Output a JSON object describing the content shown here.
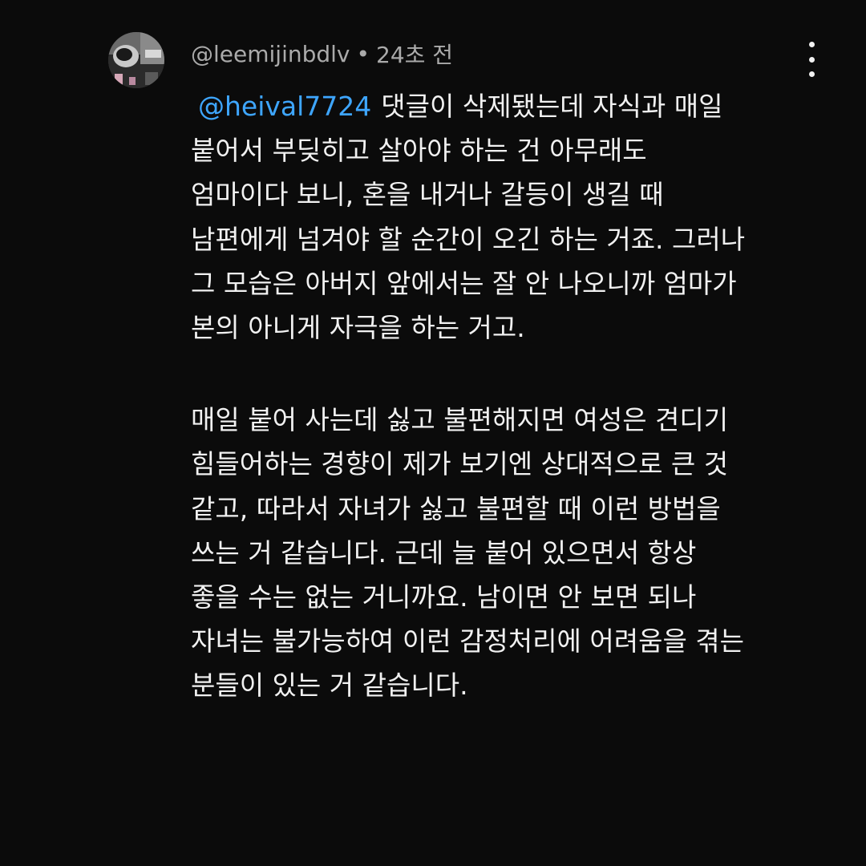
{
  "comment": {
    "author": "@leemijinbdlv",
    "separator": "•",
    "time": "24초 전",
    "reply_mention": "@heival7724",
    "paragraph_1": [
      "댓글이 삭제됐는데 자식과 매일",
      "붙어서 부딪히고 살아야 하는 건 아무래도",
      "엄마이다 보니, 혼을 내거나 갈등이 생길 때",
      "남편에게 넘겨야 할 순간이 오긴 하는 거죠. 그러나",
      "그 모습은 아버지 앞에서는 잘 안 나오니까 엄마가",
      "본의 아니게 자극을 하는 거고."
    ],
    "paragraph_2": [
      "매일 붙어 사는데 싫고 불편해지면 여성은 견디기",
      "힘들어하는 경향이 제가 보기엔 상대적으로 큰 것",
      "같고, 따라서 자녀가 싫고 불편할 때 이런 방법을",
      "쓰는 거 같습니다. 근데 늘 붙어 있으면서 항상",
      "좋을 수는 없는 거니까요. 남이면 안 보면 되나",
      "자녀는 불가능하여 이런 감정처리에 어려움을 겪는",
      "분들이 있는 거 같습니다."
    ]
  },
  "icons": {
    "avatar": "profile-photo",
    "more": "more-vertical-icon"
  },
  "colors": {
    "background": "#0b0b0b",
    "text": "#f1f1f1",
    "meta": "#aaaaaa",
    "mention": "#3ea6ff"
  }
}
